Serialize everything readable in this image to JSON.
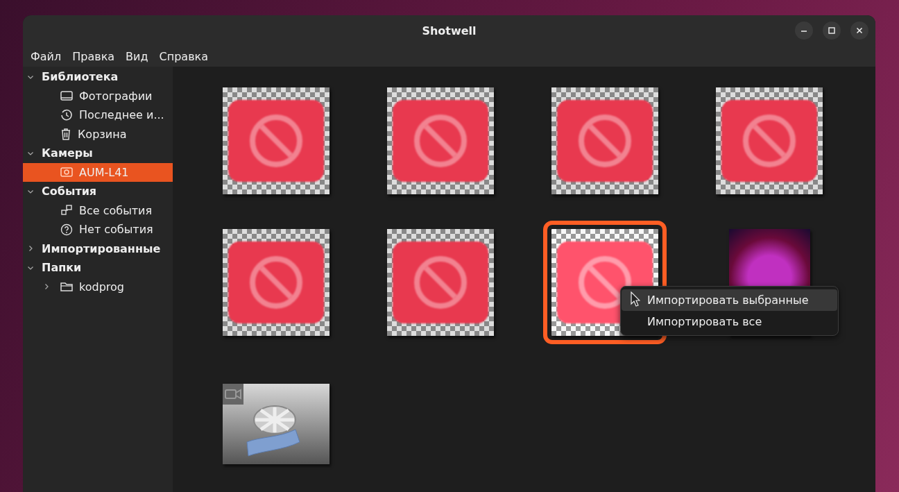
{
  "window": {
    "title": "Shotwell"
  },
  "menu": [
    "Файл",
    "Правка",
    "Вид",
    "Справка"
  ],
  "sidebar": {
    "sections": [
      {
        "label": "Библиотека",
        "expanded": true,
        "children": [
          {
            "label": "Фотографии",
            "kind": "photos",
            "selected": false
          },
          {
            "label": "Последнее и...",
            "kind": "recent",
            "selected": false
          },
          {
            "label": "Корзина",
            "kind": "trash",
            "selected": false
          }
        ]
      },
      {
        "label": "Камеры",
        "expanded": true,
        "children": [
          {
            "label": "AUM-L41",
            "kind": "camera",
            "selected": true
          }
        ]
      },
      {
        "label": "События",
        "expanded": true,
        "children": [
          {
            "label": "Все события",
            "kind": "events",
            "selected": false
          },
          {
            "label": "Нет события",
            "kind": "no-event",
            "selected": false
          }
        ]
      },
      {
        "label": "Импортированные",
        "expanded": false
      },
      {
        "label": "Папки",
        "expanded": true,
        "children": [
          {
            "label": "kodprog",
            "kind": "folder",
            "selected": false,
            "expanded": false
          }
        ]
      }
    ]
  },
  "thumbnails": [
    {
      "kind": "blocked",
      "selected": false
    },
    {
      "kind": "blocked",
      "selected": false
    },
    {
      "kind": "blocked",
      "selected": false
    },
    {
      "kind": "blocked",
      "selected": false
    },
    {
      "kind": "blocked",
      "selected": false
    },
    {
      "kind": "blocked",
      "selected": false
    },
    {
      "kind": "blocked",
      "selected": true
    },
    {
      "kind": "photo",
      "selected": false
    },
    {
      "kind": "video",
      "selected": false
    }
  ],
  "context_menu": [
    {
      "label": "Импортировать выбранные",
      "selected": true
    },
    {
      "label": "Импортировать все",
      "selected": false
    }
  ]
}
